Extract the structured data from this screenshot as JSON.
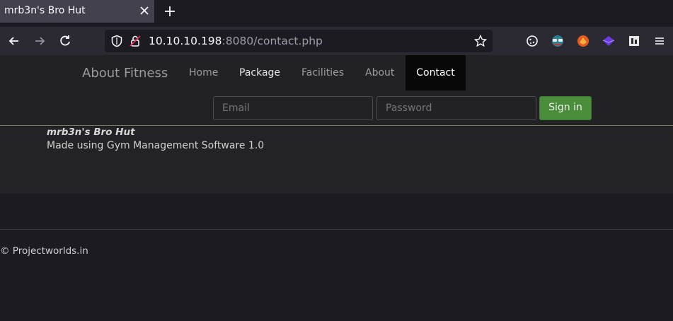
{
  "browser": {
    "tab_title": "mrb3n's Bro Hut",
    "url_host": "10.10.10.198",
    "url_rest": ":8080/contact.php",
    "icons": [
      "back-icon",
      "forward-icon",
      "reload-icon",
      "shield-icon",
      "lock-insecure-icon",
      "star-icon",
      "cookie-icon",
      "extension-icon",
      "menu-icon"
    ]
  },
  "navbar": {
    "brand": "About Fitness",
    "links": [
      "Home",
      "Package",
      "Facilities",
      "About",
      "Contact"
    ],
    "active": "Contact",
    "email_placeholder": "Email",
    "password_placeholder": "Password",
    "signin_label": "Sign in"
  },
  "hero": {
    "title": "mrb3n's Bro Hut",
    "subtitle": "Made using Gym Management Software 1.0"
  },
  "footer": {
    "copyright": "© Projectworlds.in"
  },
  "colors": {
    "accent_green": "#4a8d3a",
    "active_nav": "#080808",
    "page_bg": "#1c1b22"
  }
}
